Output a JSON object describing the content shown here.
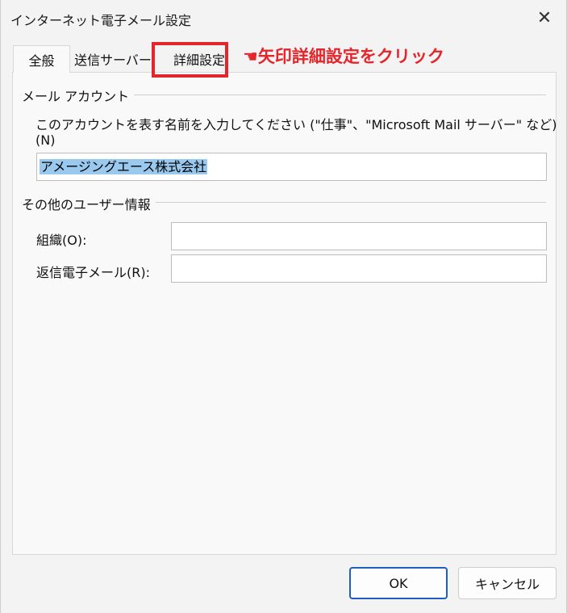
{
  "window": {
    "title": "インターネット電子メール設定",
    "close_symbol": "✕"
  },
  "tabs": [
    {
      "label": "全般",
      "active": true
    },
    {
      "label": "送信サーバー",
      "active": false
    },
    {
      "label": "詳細設定",
      "active": false
    }
  ],
  "annotation": {
    "text": "☚矢印詳細設定をクリック",
    "color": "#e3262c"
  },
  "account_group": {
    "title": "メール アカウント",
    "description": "このアカウントを表す名前を入力してください (\"仕事\"、\"Microsoft Mail サーバー\" など)",
    "accelerator": "(N)",
    "account_name_value": "アメージングエース株式会社"
  },
  "user_info_group": {
    "title": "その他のユーザー情報",
    "organization_label": "組織(O):",
    "organization_value": "",
    "reply_email_label": "返信電子メール(R):",
    "reply_email_value": ""
  },
  "buttons": {
    "ok_label": "OK",
    "cancel_label": "キャンセル"
  },
  "colors": {
    "highlight": "#e3262c",
    "selection": "#99c9ef",
    "primary_button_border": "#1f5fbf"
  }
}
